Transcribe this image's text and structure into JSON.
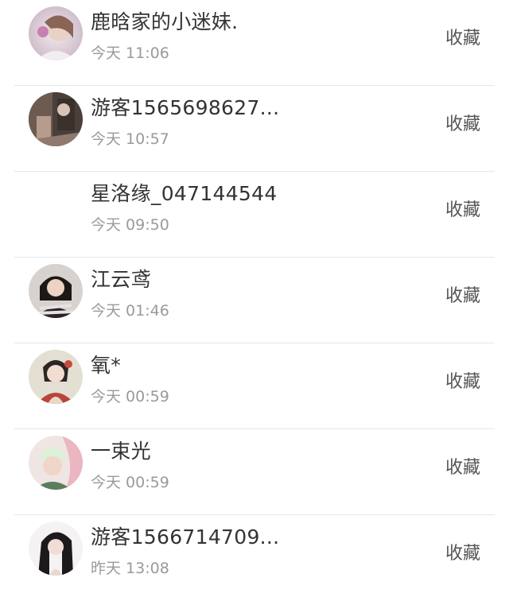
{
  "items": [
    {
      "name": "鹿晗家的小迷妹.",
      "time": "今天 11:06",
      "action": "收藏",
      "has_avatar": true
    },
    {
      "name": "游客1565698627...",
      "time": "今天 10:57",
      "action": "收藏",
      "has_avatar": true
    },
    {
      "name": "星洛缘_047144544",
      "time": "今天 09:50",
      "action": "收藏",
      "has_avatar": false
    },
    {
      "name": "江云鸢",
      "time": "今天 01:46",
      "action": "收藏",
      "has_avatar": true
    },
    {
      "name": "氧*",
      "time": "今天 00:59",
      "action": "收藏",
      "has_avatar": true
    },
    {
      "name": "一束光",
      "time": "今天 00:59",
      "action": "收藏",
      "has_avatar": true
    },
    {
      "name": "游客1566714709...",
      "time": "昨天 13:08",
      "action": "收藏",
      "has_avatar": true
    }
  ]
}
